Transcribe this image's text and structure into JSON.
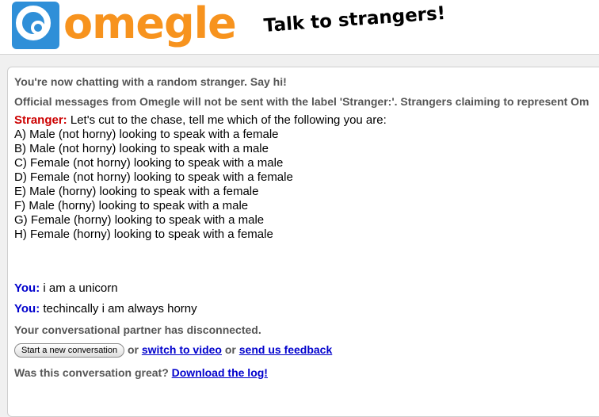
{
  "header": {
    "logo_text": "omegle",
    "tagline": "Talk to strangers!"
  },
  "status": {
    "now_chatting": "You're now chatting with a random stranger. Say hi!",
    "official_notice": "Official messages from Omegle will not be sent with the label 'Stranger:'. Strangers claiming to represent Om",
    "disconnected": "Your conversational partner has disconnected."
  },
  "messages": {
    "stranger_label": "Stranger:",
    "stranger_intro": " Let's cut to the chase, tell me which of the following you are:",
    "stranger_options": [
      "A) Male (not horny) looking to speak with a female",
      "B) Male (not horny) looking to speak with a male",
      "C) Female (not horny) looking to speak with a male",
      "D) Female (not horny) looking to speak with a female",
      "E) Male (horny) looking to speak with a female",
      "F) Male (horny) looking to speak with a male",
      "G) Female (horny) looking to speak with a male",
      "H) Female (horny) looking to speak with a female"
    ],
    "you_label": "You:",
    "you_1": " i am a unicorn",
    "you_2": " techincally i am always horny"
  },
  "actions": {
    "new_conversation": "Start a new conversation",
    "or_1": " or ",
    "switch_video": "switch to video",
    "or_2": " or ",
    "feedback": "send us feedback"
  },
  "log": {
    "question": "Was this conversation great? ",
    "download": "Download the log!"
  },
  "colors": {
    "brand_orange": "#f7931e",
    "logo_blue": "#2f8fd8",
    "stranger_red": "#cc0000",
    "you_blue": "#0000cc"
  }
}
